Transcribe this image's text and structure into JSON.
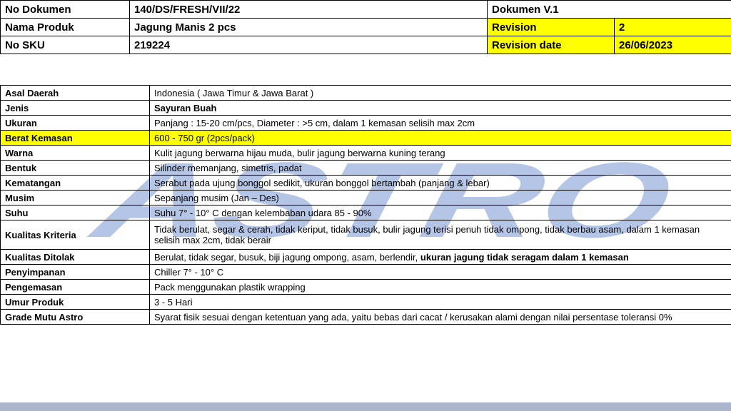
{
  "header": {
    "doc_no_label": "No Dokumen",
    "doc_no_value": "140/DS/FRESH/VII/22",
    "doc_version": "Dokumen V.1",
    "product_label": "Nama Produk",
    "product_value": "Jagung Manis 2 pcs",
    "revision_label": "Revision",
    "revision_value": "2",
    "sku_label": "No SKU",
    "sku_value": "219224",
    "revision_date_label": "Revision date",
    "revision_date_value": "26/06/2023"
  },
  "spec": {
    "asal_label": "Asal Daerah",
    "asal_value": "Indonesia ( Jawa Timur & Jawa Barat )",
    "jenis_label": "Jenis",
    "jenis_value": "Sayuran Buah",
    "ukuran_label": "Ukuran",
    "ukuran_value": "Panjang : 15-20 cm/pcs, Diameter : >5 cm, dalam 1 kemasan selisih max 2cm",
    "berat_label": "Berat Kemasan",
    "berat_value": "600 - 750 gr (2pcs/pack)",
    "warna_label": "Warna",
    "warna_value": "Kulit jagung berwarna hijau muda, bulir jagung berwarna kuning terang",
    "bentuk_label": "Bentuk",
    "bentuk_value": "Silinder memanjang, simetris, padat",
    "kematangan_label": "Kematangan",
    "kematangan_value": "Serabut pada ujung bonggol sedikit, ukuran bonggol bertambah (panjang & lebar)",
    "musim_label": "Musim",
    "musim_value": "Sepanjang musim (Jan – Des)",
    "suhu_label": "Suhu",
    "suhu_value": "Suhu 7° - 10° C dengan kelembaban udara 85 - 90%",
    "kriteria_label": "Kualitas Kriteria",
    "kriteria_value": "Tidak berulat, segar & cerah, tidak keriput, tidak busuk, bulir jagung terisi penuh tidak ompong, tidak berbau asam, dalam 1 kemasan selisih max 2cm, tidak berair",
    "ditolak_label": "Kualitas Ditolak",
    "ditolak_value": "Berulat, tidak segar, busuk, biji jagung ompong, asam, berlendir,",
    "ditolak_bold": "ukuran jagung tidak seragam dalam 1 kemasan",
    "penyimpanan_label": "Penyimpanan",
    "penyimpanan_value": "Chiller 7° - 10° C",
    "pengemasan_label": "Pengemasan",
    "pengemasan_value": "Pack menggunakan plastik wrapping",
    "umur_label": "Umur Produk",
    "umur_value": "3 - 5 Hari",
    "grade_label": "Grade Mutu Astro",
    "grade_value": "Syarat fisik sesuai dengan ketentuan yang ada, yaitu bebas dari cacat / kerusakan alami dengan  nilai persentase toleransi 0%"
  },
  "watermark": {
    "text": "ASTRO",
    "color": "#5b7fc7"
  },
  "colors": {
    "highlight": "#ffff00",
    "bottom_bar": "#aab4cb"
  }
}
